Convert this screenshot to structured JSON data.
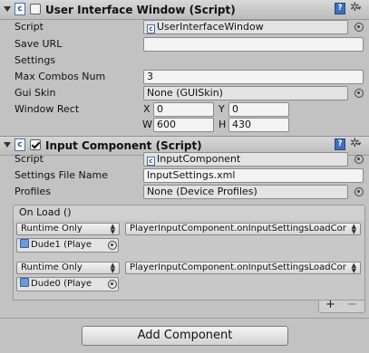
{
  "ui_window_component": {
    "title": "User Interface Window (Script)",
    "enabled": false,
    "script_label": "Script",
    "script_value": "UserInterfaceWindow",
    "save_url_label": "Save URL",
    "save_url_value": "",
    "settings_label": "Settings",
    "max_combos_label": "Max Combos Num",
    "max_combos_value": "3",
    "gui_skin_label": "Gui Skin",
    "gui_skin_value": "None (GUISkin)",
    "window_rect_label": "Window Rect",
    "rect": {
      "x_label": "X",
      "x_value": "0",
      "y_label": "Y",
      "y_value": "0",
      "w_label": "W",
      "w_value": "600",
      "h_label": "H",
      "h_value": "430"
    }
  },
  "input_component": {
    "title": "Input Component (Script)",
    "enabled": true,
    "script_label": "Script",
    "script_value": "InputComponent",
    "settings_file_label": "Settings File Name",
    "settings_file_value": "InputSettings.xml",
    "profiles_label": "Profiles",
    "profiles_value": "None (Device Profiles)",
    "on_load": {
      "header": "On Load ()",
      "entries": [
        {
          "mode": "Runtime Only",
          "function": "PlayerInputComponent.onInputSettingsLoadCor",
          "target": "Dude1 (Playe"
        },
        {
          "mode": "Runtime Only",
          "function": "PlayerInputComponent.onInputSettingsLoadCor",
          "target": "Dude0 (Playe"
        }
      ],
      "add_label": "+",
      "remove_label": "−"
    }
  },
  "add_component_label": "Add Component",
  "icons": {
    "foldout": "foldout-arrow-icon",
    "script": "script-icon",
    "help": "help-book-icon",
    "gear": "gear-icon",
    "object_picker": "object-picker-icon",
    "gameobject": "gameobject-icon"
  },
  "colors": {
    "background": "#c2c2c2",
    "header": "#c8c8c8",
    "field": "#f3f3f3",
    "help_icon": "#3f6fc0"
  }
}
